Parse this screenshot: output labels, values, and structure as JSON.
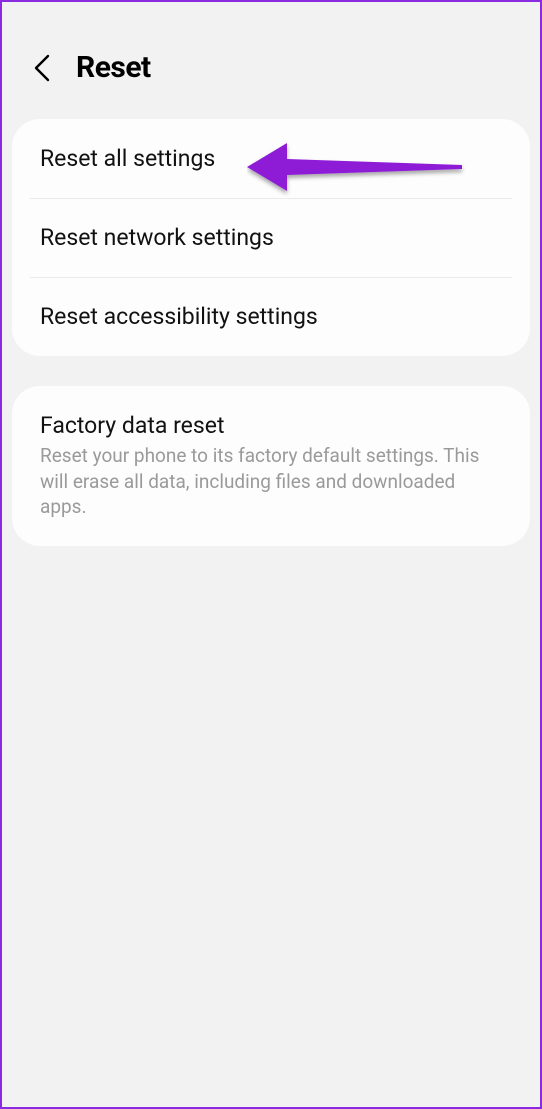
{
  "header": {
    "title": "Reset"
  },
  "group1": {
    "items": [
      {
        "label": "Reset all settings"
      },
      {
        "label": "Reset network settings"
      },
      {
        "label": "Reset accessibility settings"
      }
    ]
  },
  "group2": {
    "items": [
      {
        "label": "Factory data reset",
        "description": "Reset your phone to its factory default settings. This will erase all data, including files and downloaded apps."
      }
    ]
  }
}
